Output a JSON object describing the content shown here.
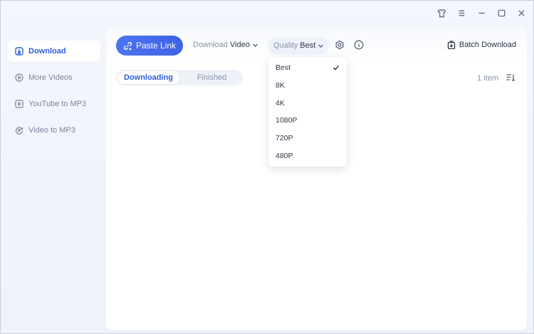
{
  "sidebar": {
    "items": [
      {
        "label": "Download",
        "icon": "download-icon",
        "active": true
      },
      {
        "label": "More Videos",
        "icon": "play-circle-icon"
      },
      {
        "label": "YouTube to MP3",
        "icon": "play-square-icon"
      },
      {
        "label": "Video to MP3",
        "icon": "convert-icon"
      }
    ]
  },
  "toolbar": {
    "paste_label": "Paste Link",
    "download_prefix": "Download",
    "download_value": "Video",
    "quality_prefix": "Quality",
    "quality_value": "Best",
    "batch_label": "Batch Download"
  },
  "tabs": [
    {
      "label": "Downloading",
      "active": true
    },
    {
      "label": "Finished"
    }
  ],
  "item_count": "1 item",
  "quality_options": [
    {
      "label": "Best",
      "selected": true
    },
    {
      "label": "8K"
    },
    {
      "label": "4K"
    },
    {
      "label": "1080P"
    },
    {
      "label": "720P"
    },
    {
      "label": "480P"
    }
  ],
  "colors": {
    "accent": "#3d62e6",
    "active_text": "#2d5fd8",
    "background": "#eef2f9"
  }
}
